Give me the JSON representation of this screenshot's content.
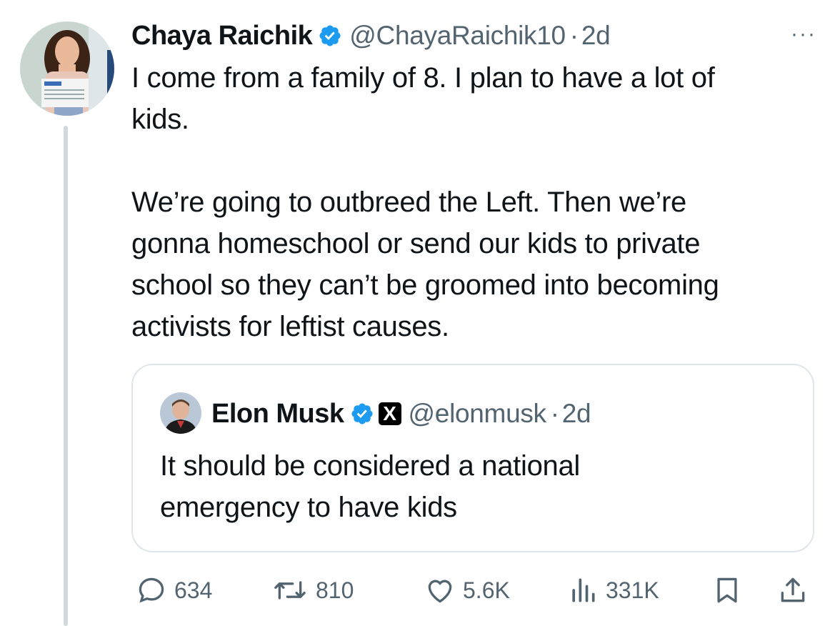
{
  "tweet": {
    "author_name": "Chaya Raichik",
    "author_handle": "@ChayaRaichik10",
    "separator": "·",
    "time": "2d",
    "more_label": "···",
    "text": "I come from a family of 8. I plan to have a lot of\nkids.\n\nWe’re going to outbreed the Left. Then we’re\ngonna homeschool or send our kids to private\nschool so they can’t be groomed into becoming\nactivists for leftist causes."
  },
  "quote": {
    "author_name": "Elon Musk",
    "badge_letter": "X",
    "author_handle": "@elonmusk",
    "separator": "·",
    "time": "2d",
    "text": "It should be considered a national\nemergency to have kids"
  },
  "actions": {
    "replies": "634",
    "reposts": "810",
    "likes": "5.6K",
    "views": "331K"
  },
  "colors": {
    "verified": "#1d9bf0",
    "secondary_text": "#536471",
    "border": "#dfe5e9"
  },
  "icons": [
    "verified-badge-icon",
    "more-icon",
    "reply-icon",
    "repost-icon",
    "like-icon",
    "views-icon",
    "bookmark-icon",
    "share-icon"
  ]
}
